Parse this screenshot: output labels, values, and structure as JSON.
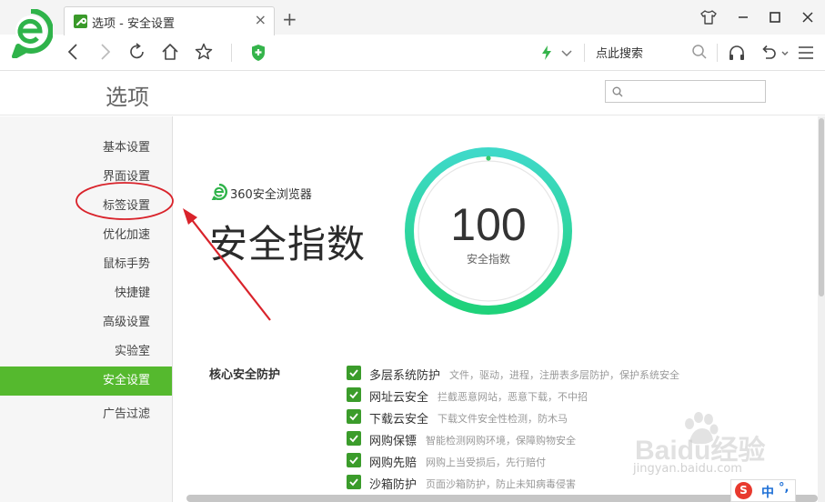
{
  "browser": {
    "tab_title": "选项 - 安全设置",
    "tab_close": "×",
    "new_tab": "+",
    "search_placeholder": "点此搜索"
  },
  "page": {
    "title": "选项"
  },
  "sidebar": {
    "items": [
      {
        "label": "基本设置",
        "active": false
      },
      {
        "label": "界面设置",
        "active": false
      },
      {
        "label": "标签设置",
        "active": false
      },
      {
        "label": "优化加速",
        "active": false
      },
      {
        "label": "鼠标手势",
        "active": false
      },
      {
        "label": "快捷键",
        "active": false
      },
      {
        "label": "高级设置",
        "active": false
      },
      {
        "label": "实验室",
        "active": false
      },
      {
        "label": "安全设置",
        "active": true
      },
      {
        "label": "广告过滤",
        "active": false
      }
    ]
  },
  "security": {
    "brand": "360安全浏览器",
    "heading": "安全指数",
    "score": "100",
    "score_label": "安全指数",
    "core_label": "核心安全防护",
    "options": [
      {
        "name": "多层系统防护",
        "desc": "文件，驱动，进程，注册表多层防护，保护系统安全",
        "checked": true
      },
      {
        "name": "网址云安全",
        "desc": "拦截恶意网站，恶意下载，不中招",
        "checked": true
      },
      {
        "name": "下载云安全",
        "desc": "下载文件安全性检测，防木马",
        "checked": true
      },
      {
        "name": "网购保镖",
        "desc": "智能检测网购环境，保障购物安全",
        "checked": true
      },
      {
        "name": "网购先赔",
        "desc": "网购上当受损后，先行赔付",
        "checked": true
      },
      {
        "name": "沙箱防护",
        "desc": "页面沙箱防护，防止未知病毒侵害",
        "checked": true
      }
    ]
  },
  "watermark": {
    "text": "Baidu经验",
    "url": "jingyan.baidu.com"
  },
  "ime": {
    "logo": "S",
    "mode": "中",
    "punct": "°,"
  },
  "colors": {
    "accent_green": "#55b92e",
    "checkbox_green": "#3b9c2b",
    "gauge_start": "#3fd9c9",
    "gauge_end": "#1fd27a",
    "annotation_red": "#d9232b"
  }
}
